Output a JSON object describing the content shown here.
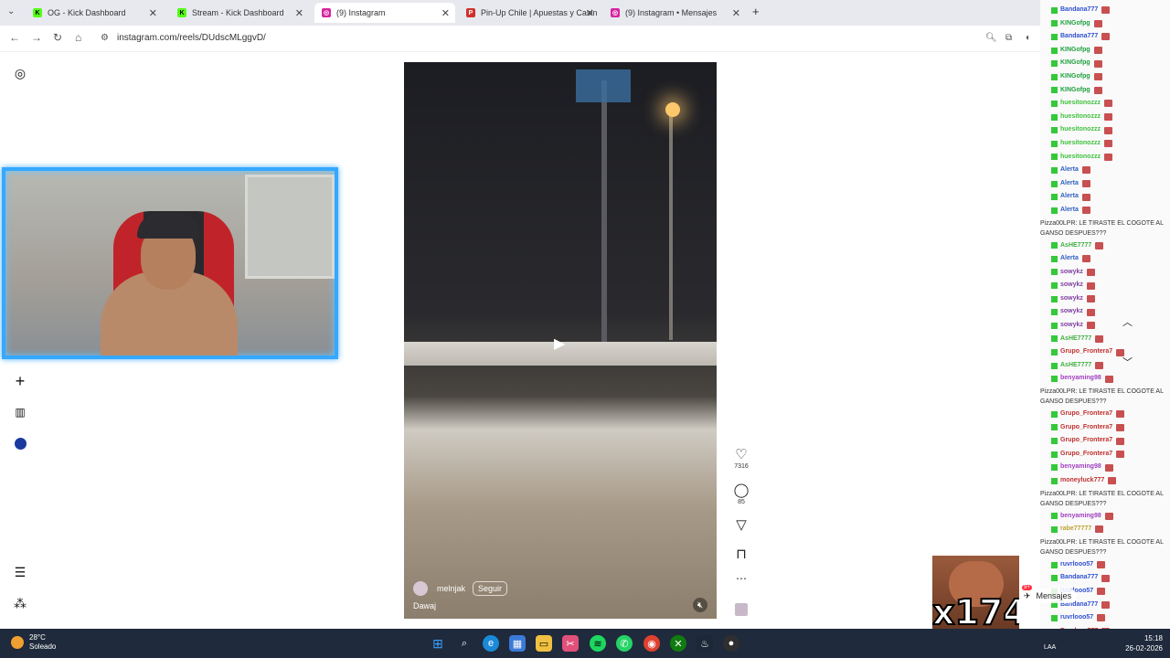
{
  "browser": {
    "tabs": [
      {
        "label": "OG - Kick Dashboard",
        "icon": "kick-icon",
        "color": "#53fc18"
      },
      {
        "label": "Stream - Kick Dashboard",
        "icon": "kick-icon",
        "color": "#53fc18"
      },
      {
        "label": "(9) Instagram",
        "icon": "instagram-icon",
        "color": "#d6249f"
      },
      {
        "label": "Pin-Up Chile | Apuestas y Casin",
        "icon": "pinup-icon",
        "color": "#d0302a"
      },
      {
        "label": "(9) Instagram • Mensajes",
        "icon": "instagram-icon",
        "color": "#d6249f"
      }
    ],
    "url": "instagram.com/reels/DUdscMLggvD/"
  },
  "reel": {
    "username": "melnjak",
    "follow_label": "Seguir",
    "caption": "Dawaj",
    "likes": "7316",
    "comments": "85"
  },
  "chat": {
    "messages": [
      {
        "user": "Bandana777",
        "color": "#3050d0"
      },
      {
        "user": "KINGofpg",
        "color": "#20a040"
      },
      {
        "user": "Bandana777",
        "color": "#3050d0"
      },
      {
        "user": "KINGofpg",
        "color": "#20a040"
      },
      {
        "user": "KINGofpg",
        "color": "#20a040"
      },
      {
        "user": "KINGofpg",
        "color": "#20a040"
      },
      {
        "user": "KINGofpg",
        "color": "#20a040"
      },
      {
        "user": "huesitonozzz",
        "color": "#40c040"
      },
      {
        "user": "huesitonozzz",
        "color": "#40c040"
      },
      {
        "user": "huesitonozzz",
        "color": "#40c040"
      },
      {
        "user": "huesitonozzz",
        "color": "#40c040"
      },
      {
        "user": "huesitonozzz",
        "color": "#40c040"
      },
      {
        "user": "Alerta",
        "color": "#3060c0"
      },
      {
        "user": "Alerta",
        "color": "#3060c0"
      },
      {
        "user": "Alerta",
        "color": "#3060c0"
      },
      {
        "user": "Alerta",
        "color": "#3060c0"
      }
    ],
    "long_message": "Pizza00LPR: LE TIRASTE EL COGOTE AL GANSO DESPUES???",
    "more_messages": [
      {
        "user": "AsHE7777",
        "color": "#40b040"
      },
      {
        "user": "Alerta",
        "color": "#3060c0"
      },
      {
        "user": "sowykz",
        "color": "#8040a0"
      },
      {
        "user": "sowykz",
        "color": "#8040a0"
      },
      {
        "user": "sowykz",
        "color": "#8040a0"
      },
      {
        "user": "sowykz",
        "color": "#8040a0"
      },
      {
        "user": "sowykz",
        "color": "#8040a0"
      },
      {
        "user": "AsHE7777",
        "color": "#40b040"
      },
      {
        "user": "Grupo_Frontera7",
        "color": "#c03030"
      },
      {
        "user": "AsHE7777",
        "color": "#40b040"
      },
      {
        "user": "benyaming98",
        "color": "#a040c0"
      }
    ],
    "tail_messages": [
      {
        "user": "Grupo_Frontera7",
        "color": "#c03030"
      },
      {
        "user": "Grupo_Frontera7",
        "color": "#c03030"
      },
      {
        "user": "Grupo_Frontera7",
        "color": "#c03030"
      },
      {
        "user": "Grupo_Frontera7",
        "color": "#c03030"
      },
      {
        "user": "benyaming98",
        "color": "#a040c0"
      },
      {
        "user": "moneyluck777",
        "color": "#c03030"
      }
    ],
    "final_messages": [
      {
        "user": "benyaming98",
        "color": "#a040c0"
      },
      {
        "user": "rabe77777",
        "color": "#c0a030"
      }
    ],
    "end_messages": [
      {
        "user": "ruvrlooo57",
        "color": "#3050d0"
      },
      {
        "user": "Bandana777",
        "color": "#3050d0"
      },
      {
        "user": "ruvrlooo57",
        "color": "#3050d0"
      },
      {
        "user": "Bandana777",
        "color": "#3050d0"
      },
      {
        "user": "ruvrlooo57",
        "color": "#3050d0"
      },
      {
        "user": "Bandana777",
        "color": "#c03030"
      }
    ],
    "messages_badge": "9+",
    "messages_label": "Mensajes"
  },
  "overlay": {
    "multiplier": "x174"
  },
  "taskbar": {
    "weather_temp": "28°C",
    "weather_text": "Soleado",
    "lang": "LAA",
    "time": "15:18",
    "date": "26-02-2026"
  }
}
